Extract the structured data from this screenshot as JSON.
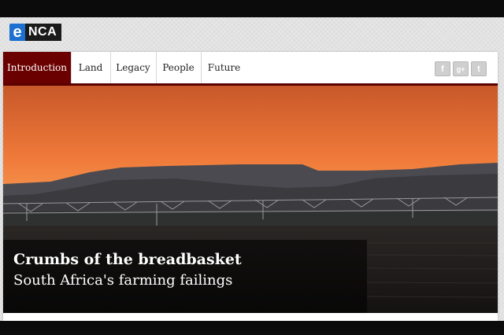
{
  "logo": {
    "e": "e",
    "rest": "NCA"
  },
  "nav": {
    "tabs": [
      {
        "label": "Introduction",
        "active": true
      },
      {
        "label": "Land",
        "active": false
      },
      {
        "label": "Legacy",
        "active": false
      },
      {
        "label": "People",
        "active": false
      },
      {
        "label": "Future",
        "active": false
      }
    ]
  },
  "social": [
    {
      "icon": "facebook-icon",
      "glyph": "f"
    },
    {
      "icon": "google-plus-icon",
      "glyph": "g+"
    },
    {
      "icon": "twitter-icon",
      "glyph": "t"
    }
  ],
  "hero": {
    "title": "Crumbs of the breadbasket",
    "subtitle": "South Africa's farming failings",
    "colors": {
      "sky_top": "#c8582a",
      "sky_mid": "#f07a3a",
      "sky_horizon": "#f7a45a",
      "hills": "#3f3f45",
      "field": "#1d1b1a"
    }
  },
  "colors": {
    "accent": "#6b0000",
    "nav_border": "#5a0000"
  }
}
